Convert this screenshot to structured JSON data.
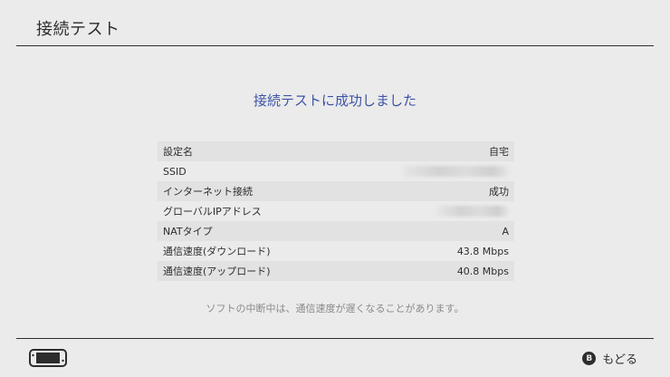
{
  "header": {
    "title": "接続テスト"
  },
  "result": {
    "message": "接続テストに成功しました"
  },
  "rows": [
    {
      "label": "設定名",
      "value": "自宅"
    },
    {
      "label": "SSID",
      "value": ""
    },
    {
      "label": "インターネット接続",
      "value": "成功"
    },
    {
      "label": "グローバルIPアドレス",
      "value": ""
    },
    {
      "label": "NATタイプ",
      "value": "A"
    },
    {
      "label": "通信速度(ダウンロード)",
      "value": "43.8 Mbps"
    },
    {
      "label": "通信速度(アップロード)",
      "value": "40.8 Mbps"
    }
  ],
  "note": "ソフトの中断中は、通信速度が遅くなることがあります。",
  "footer": {
    "back_button_glyph": "B",
    "back_label": "もどる",
    "console_icon": "switch-console-icon"
  },
  "colors": {
    "accent": "#3c53a6",
    "background": "#ebebeb",
    "text": "#2d2d2d"
  }
}
